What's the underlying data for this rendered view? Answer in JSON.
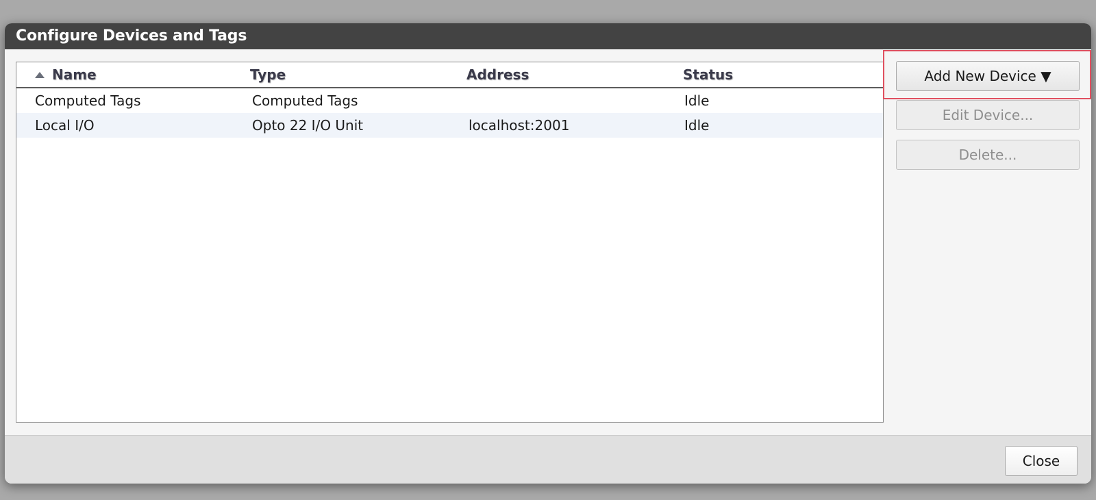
{
  "dialog": {
    "title": "Configure Devices and Tags"
  },
  "table": {
    "sort_icon": "sort-ascending-icon",
    "columns": [
      "Name",
      "Type",
      "Address",
      "Status"
    ],
    "rows": [
      {
        "name": "Computed Tags",
        "type": "Computed Tags",
        "address": "",
        "status": "Idle"
      },
      {
        "name": "Local I/O",
        "type": "Opto 22 I/O Unit",
        "address": "localhost:2001",
        "status": "Idle"
      }
    ]
  },
  "actions": {
    "add_label": "Add New Device ▼",
    "edit_label": "Edit Device...",
    "delete_label": "Delete..."
  },
  "footer": {
    "close_label": "Close"
  },
  "colors": {
    "titlebar": "#434343",
    "highlight": "#e05060",
    "row_alt": "#f0f4fa"
  }
}
